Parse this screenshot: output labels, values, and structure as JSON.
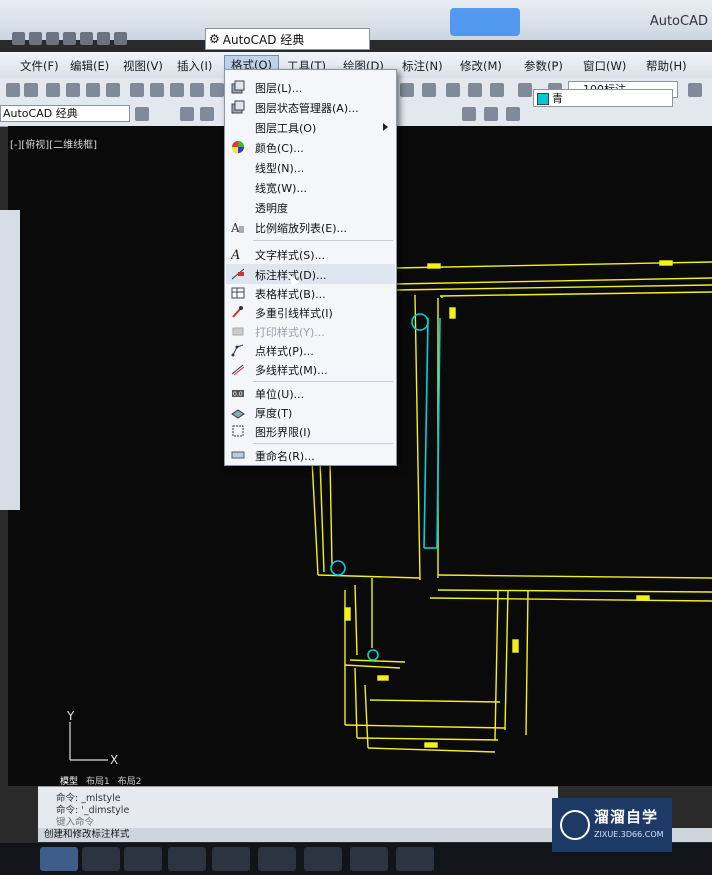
{
  "title_bar": {
    "workspace": "AutoCAD 经典",
    "app_title": "AutoCAD"
  },
  "menubar": {
    "items": [
      "文件(F)",
      "编辑(E)",
      "视图(V)",
      "插入(I)",
      "格式(O)",
      "工具(T)",
      "绘图(D)",
      "标注(N)",
      "修改(M)",
      "参数(P)",
      "窗口(W)",
      "帮助(H)"
    ]
  },
  "toolbar": {
    "dimstyle": "100标注",
    "workspace": "AutoCAD 经典",
    "color": "青"
  },
  "viewport_label": "[-][俯视][二维线框]",
  "format_menu": {
    "items": [
      {
        "label": "图层(L)...",
        "icon": "layers-icon"
      },
      {
        "label": "图层状态管理器(A)...",
        "icon": "layer-state-icon"
      },
      {
        "label": "图层工具(O)",
        "icon": "",
        "submenu": true
      },
      {
        "label": "颜色(C)...",
        "icon": "color-wheel-icon"
      },
      {
        "label": "线型(N)...",
        "icon": ""
      },
      {
        "label": "线宽(W)...",
        "icon": ""
      },
      {
        "label": "透明度",
        "icon": ""
      },
      {
        "label": "比例缩放列表(E)...",
        "icon": "scale-list-icon"
      },
      {
        "label": "文字样式(S)...",
        "icon": "text-style-icon"
      },
      {
        "label": "标注样式(D)...",
        "icon": "dim-style-icon"
      },
      {
        "label": "表格样式(B)...",
        "icon": "table-style-icon"
      },
      {
        "label": "多重引线样式(I)",
        "icon": "mleader-style-icon"
      },
      {
        "label": "打印样式(Y)...",
        "icon": "plot-style-icon",
        "disabled": true
      },
      {
        "label": "点样式(P)...",
        "icon": "point-style-icon"
      },
      {
        "label": "多线样式(M)...",
        "icon": "mline-style-icon"
      },
      {
        "label": "单位(U)...",
        "icon": "units-icon"
      },
      {
        "label": "厚度(T)",
        "icon": "thickness-icon"
      },
      {
        "label": "图形界限(I)",
        "icon": "limits-icon"
      },
      {
        "label": "重命名(R)...",
        "icon": "rename-icon"
      }
    ]
  },
  "layout_tabs": [
    "模型",
    "布局1",
    "布局2"
  ],
  "command": {
    "line1": "命令: _mlstyle",
    "line2": "命令: '_dimstyle",
    "prompt": "键入命令"
  },
  "status_text": "创建和修改标注样式",
  "watermark": {
    "name": "溜溜自学",
    "url": "ZIXUE.3D66.COM"
  },
  "colors": {
    "drawing_line": "#f2f21a",
    "highlight": "#00d0e0",
    "canvas": "#0a0a0a"
  }
}
